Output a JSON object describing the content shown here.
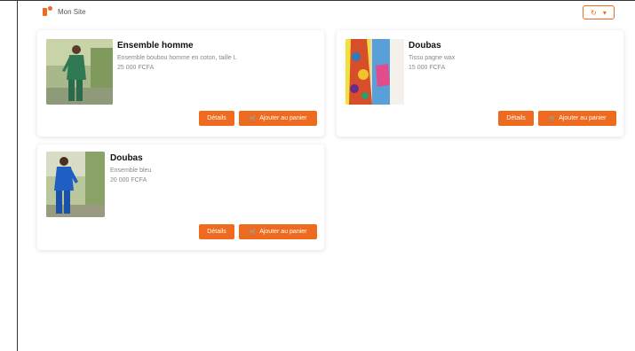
{
  "app": {
    "brand": "Mon Site"
  },
  "header": {
    "menu_icon": "refresh-icon",
    "menu_caret": "▾"
  },
  "colors": {
    "accent": "#ee6a1e",
    "background": "#ffffff",
    "text": "#111111",
    "muted": "#888888"
  },
  "products": [
    {
      "title": "Ensemble homme",
      "description": "Ensemble boubou homme en coton, taille L",
      "price": "25 000 FCFA",
      "details_label": "Détails",
      "cart_label": "Ajouter au panier",
      "cart_icon": "cart-icon"
    },
    {
      "title": "Doubas",
      "description": "Tissu pagne wax",
      "price": "15 000 FCFA",
      "details_label": "Détails",
      "cart_label": "Ajouter au panier",
      "cart_icon": "cart-icon"
    },
    {
      "title": "Doubas",
      "description": "Ensemble bleu",
      "price": "20 000 FCFA",
      "details_label": "Détails",
      "cart_label": "Ajouter au panier",
      "cart_icon": "cart-icon"
    }
  ]
}
